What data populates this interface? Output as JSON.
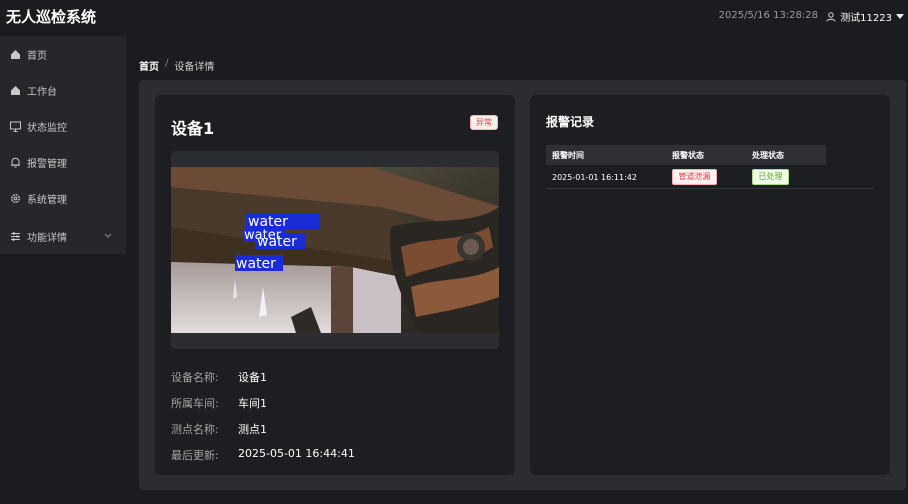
{
  "app": {
    "title": "无人巡检系统"
  },
  "header": {
    "datetime": "2025/5/16 13:28:28",
    "user_name": "测试11223"
  },
  "sidebar": {
    "items": [
      {
        "label": "首页",
        "icon": "home-icon"
      },
      {
        "label": "工作台",
        "icon": "home-icon"
      },
      {
        "label": "状态监控",
        "icon": "monitor-icon"
      },
      {
        "label": "报警管理",
        "icon": "bell-icon"
      },
      {
        "label": "系统管理",
        "icon": "gear-icon"
      },
      {
        "label": "功能详情",
        "icon": "sliders-icon",
        "expandable": true
      }
    ]
  },
  "breadcrumb": {
    "home": "首页",
    "separator": "/",
    "current": "设备详情"
  },
  "device": {
    "title": "设备1",
    "status": "异常",
    "camera_labels": [
      "water",
      "water",
      "water",
      "water"
    ],
    "info": [
      {
        "label": "设备名称:",
        "value": "设备1"
      },
      {
        "label": "所属车间:",
        "value": "车间1"
      },
      {
        "label": "测点名称:",
        "value": "测点1"
      },
      {
        "label": "最后更新:",
        "value": "2025-05-01 16:44:41"
      }
    ]
  },
  "alarms": {
    "title": "报警记录",
    "columns": [
      "报警时间",
      "报警状态",
      "处理状态"
    ],
    "rows": [
      {
        "time": "2025-01-01 16:11:42",
        "alarm_status": "管道泄漏",
        "handle_status": "已处理"
      }
    ]
  },
  "colors": {
    "danger": "#e04848",
    "success": "#52a93a",
    "detection_box": "#1a2bd8"
  }
}
